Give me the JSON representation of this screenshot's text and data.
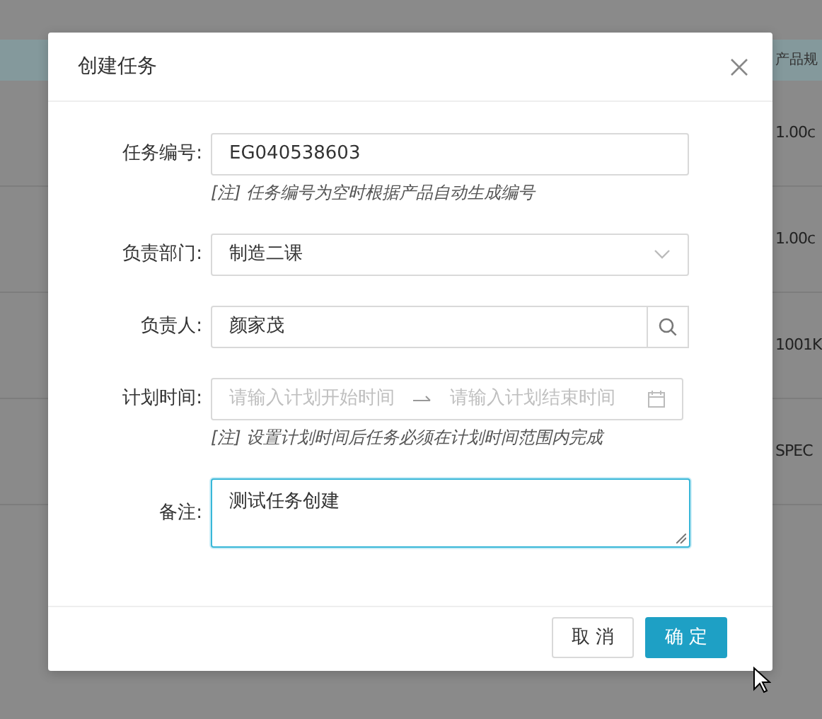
{
  "background_table": {
    "columns": [
      "产品规"
    ],
    "rows": [
      [
        "1.00c"
      ],
      [
        "1.00c"
      ],
      [
        "1001K"
      ],
      [
        "SPEC"
      ]
    ]
  },
  "dialog": {
    "title": "创建任务",
    "fields": [
      {
        "kind": "text",
        "label": "任务编号:",
        "value": "EG040538603",
        "note": "[注] 任务编号为空时根据产品自动生成编号"
      },
      {
        "kind": "select",
        "label": "负责部门:",
        "value": "制造二课"
      },
      {
        "kind": "search",
        "label": "负责人:",
        "value": "颜家茂"
      },
      {
        "kind": "daterange",
        "label": "计划时间:",
        "start_placeholder": "请输入计划开始时间",
        "end_placeholder": "请输入计划结束时间",
        "note": "[注] 设置计划时间后任务必须在计划时间范围内完成"
      },
      {
        "kind": "textarea",
        "label": "备注:",
        "value": "测试任务创建",
        "focused": true
      }
    ],
    "buttons": [
      {
        "label": "取 消",
        "primary": false
      },
      {
        "label": "确 定",
        "primary": true
      }
    ]
  }
}
